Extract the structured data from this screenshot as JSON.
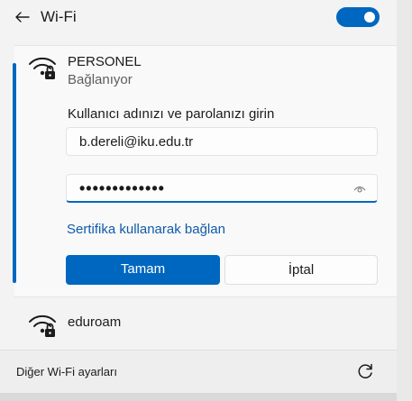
{
  "header": {
    "back_icon": "arrow-left-icon",
    "title": "Wi-Fi",
    "wifi_enabled": true,
    "accent_color": "#0067c0"
  },
  "active_network": {
    "icon": "wifi-secured-icon",
    "name": "PERSONEL",
    "status": "Bağlanıyor",
    "prompt": "Kullanıcı adınızı ve parolanızı girin",
    "username_value": "b.dereli@iku.edu.tr",
    "password_mask": "•••••••••••••",
    "reveal_icon": "eye-icon",
    "certificate_link": "Sertifika kullanarak bağlan",
    "ok_label": "Tamam",
    "cancel_label": "İptal"
  },
  "networks": [
    {
      "icon": "wifi-secured-icon",
      "name": "eduroam"
    }
  ],
  "footer": {
    "settings_link": "Diğer Wi-Fi ayarları",
    "refresh_icon": "refresh-icon"
  }
}
